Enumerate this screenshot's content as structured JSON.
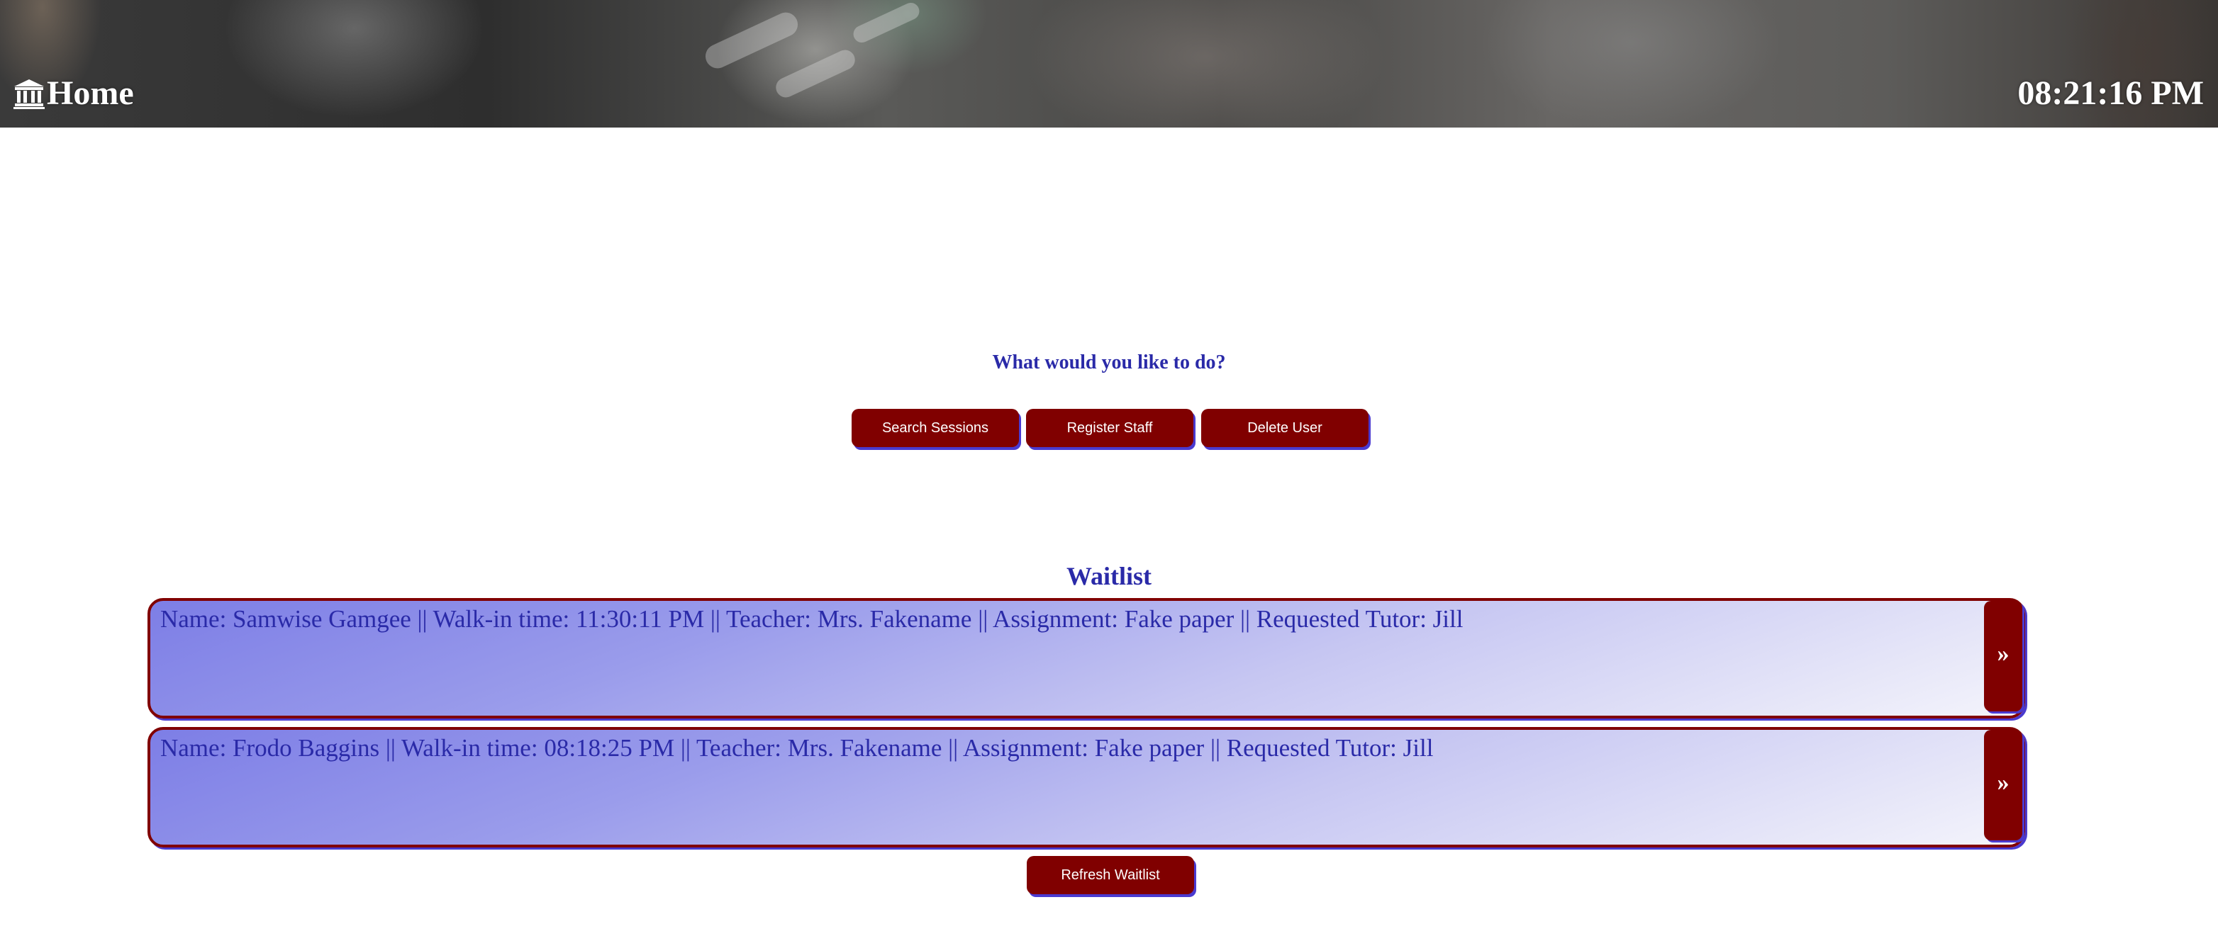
{
  "header": {
    "home_label": "Home",
    "home_icon": "bank-icon",
    "clock": "08:21:16 PM"
  },
  "main": {
    "prompt": "What would you like to do?",
    "actions": [
      {
        "label": "Search Sessions"
      },
      {
        "label": "Register Staff"
      },
      {
        "label": "Delete User"
      }
    ]
  },
  "waitlist": {
    "title": "Waitlist",
    "entries": [
      {
        "text": "Name: Samwise Gamgee || Walk-in time: 11:30:11 PM || Teacher: Mrs. Fakename || Assignment: Fake paper || Requested Tutor: Jill",
        "action_label": "»"
      },
      {
        "text": "Name: Frodo Baggins || Walk-in time: 08:18:25 PM || Teacher: Mrs. Fakename || Assignment: Fake paper || Requested Tutor: Jill",
        "action_label": "»"
      }
    ],
    "refresh_label": "Refresh Waitlist"
  },
  "colors": {
    "accent": "#800000",
    "text": "#2a2aa8",
    "shadow": "#4a3ad0"
  }
}
